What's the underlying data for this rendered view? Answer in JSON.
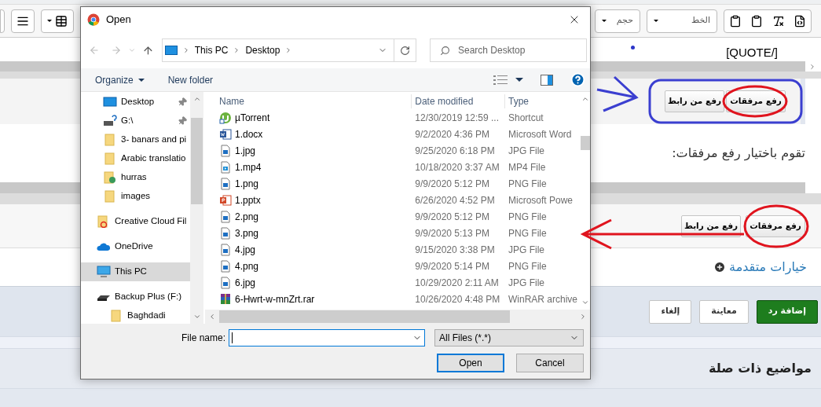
{
  "editor": {
    "size_label": "حجم",
    "font_label": "الخط",
    "content_text": "[QUOTE/]"
  },
  "upload_panels": [
    {
      "buttons": [
        "رفع مرفقات",
        "رفع من رابط"
      ]
    },
    {
      "buttons": [
        "رفع مرفقات",
        "رفع من رابط"
      ]
    }
  ],
  "instruction": "تقوم باختيار رفع مرفقات:",
  "advanced_options": "خيارات متقدمة",
  "actions": [
    {
      "label": "إضافة رد",
      "kind": "primary"
    },
    {
      "label": "معاينة",
      "kind": "default"
    },
    {
      "label": "إلغاء",
      "kind": "default"
    }
  ],
  "related_heading": "مواضيع ذات صلة",
  "dialog": {
    "title": "Open",
    "path": [
      "This PC",
      "Desktop"
    ],
    "search_placeholder": "Search Desktop",
    "organize": "Organize",
    "new_folder": "New folder",
    "nav_items": [
      {
        "label": "Desktop",
        "kind": "desktop",
        "pinned": true,
        "selected": false
      },
      {
        "label": "G:\\",
        "kind": "drive",
        "pinned": true,
        "selected": false
      },
      {
        "label": "3- banars and pi",
        "kind": "folder",
        "pinned": false,
        "selected": false
      },
      {
        "label": "Arabic translatio",
        "kind": "folder",
        "pinned": false,
        "selected": false
      },
      {
        "label": "hurras",
        "kind": "netfolder",
        "pinned": false,
        "selected": false
      },
      {
        "label": "images",
        "kind": "folder",
        "pinned": false,
        "selected": false
      },
      {
        "label": "Creative Cloud Fil",
        "kind": "cloudfolder",
        "pinned": false,
        "selected": false
      },
      {
        "label": "OneDrive",
        "kind": "onedrive",
        "pinned": false,
        "selected": false
      },
      {
        "label": "This PC",
        "kind": "pc",
        "pinned": false,
        "selected": true
      },
      {
        "label": "Backup Plus (F:)",
        "kind": "hdd",
        "pinned": false,
        "selected": false,
        "children": [
          {
            "label": "Baghdadi",
            "kind": "folder",
            "pinned": false,
            "selected": false
          }
        ]
      }
    ],
    "columns": [
      "Name",
      "Date modified",
      "Type"
    ],
    "files": [
      {
        "name": "µTorrent",
        "date": "12/30/2019 12:59 ...",
        "type": "Shortcut",
        "kind": "shortcut"
      },
      {
        "name": "1.docx",
        "date": "9/2/2020 4:36 PM",
        "type": "Microsoft Word",
        "kind": "word"
      },
      {
        "name": "1.jpg",
        "date": "9/25/2020 6:18 PM",
        "type": "JPG File",
        "kind": "image"
      },
      {
        "name": "1.mp4",
        "date": "10/18/2020 3:37 AM",
        "type": "MP4 File",
        "kind": "video"
      },
      {
        "name": "1.png",
        "date": "9/9/2020 5:12 PM",
        "type": "PNG File",
        "kind": "image"
      },
      {
        "name": "1.pptx",
        "date": "6/26/2020 4:52 PM",
        "type": "Microsoft Powe",
        "kind": "powerpoint"
      },
      {
        "name": "2.png",
        "date": "9/9/2020 5:12 PM",
        "type": "PNG File",
        "kind": "image"
      },
      {
        "name": "3.png",
        "date": "9/9/2020 5:13 PM",
        "type": "PNG File",
        "kind": "image"
      },
      {
        "name": "4.jpg",
        "date": "9/15/2020 3:38 PM",
        "type": "JPG File",
        "kind": "image"
      },
      {
        "name": "4.png",
        "date": "9/9/2020 5:14 PM",
        "type": "PNG File",
        "kind": "image"
      },
      {
        "name": "6.jpg",
        "date": "10/29/2020 2:11 AM",
        "type": "JPG File",
        "kind": "image"
      },
      {
        "name": "6-Hwrt-w-mnZrt.rar",
        "date": "10/26/2020 4:48 PM",
        "type": "WinRAR archive",
        "kind": "archive"
      }
    ],
    "file_name_label": "File name:",
    "filter": "All Files (*.*)",
    "buttons": [
      {
        "label": "Open",
        "kind": "primary"
      },
      {
        "label": "Cancel",
        "kind": "default"
      }
    ]
  }
}
